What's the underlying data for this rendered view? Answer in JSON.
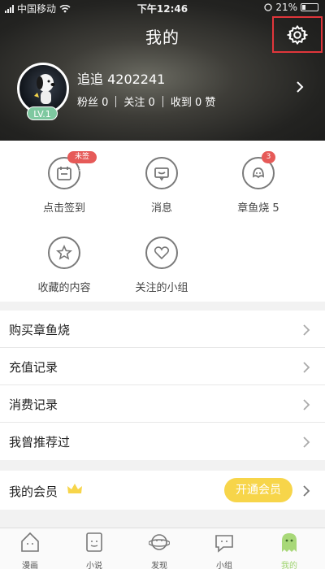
{
  "status_bar": {
    "carrier": "中国移动",
    "time": "下午12:46",
    "battery": "21%"
  },
  "header": {
    "title": "我的",
    "username": "追追 4202241",
    "level": "LV.1",
    "stats": {
      "fans": "粉丝 0",
      "follow": "关注 0",
      "likes": "收到 0 赞"
    }
  },
  "grid": {
    "items": [
      {
        "label": "点击签到",
        "icon": "checkin-icon",
        "tag": "未签到"
      },
      {
        "label": "消息",
        "icon": "message-icon"
      },
      {
        "label": "章鱼烧 5",
        "icon": "octopus-icon",
        "tag": "3"
      },
      {
        "label": "收藏的内容",
        "icon": "star-icon"
      },
      {
        "label": "关注的小组",
        "icon": "heart-icon"
      }
    ]
  },
  "list": {
    "items": [
      {
        "label": "购买章鱼烧"
      },
      {
        "label": "充值记录"
      },
      {
        "label": "消费记录"
      },
      {
        "label": "我曾推荐过"
      }
    ]
  },
  "member": {
    "label": "我的会员",
    "button": "开通会员"
  },
  "tabs": [
    {
      "label": "漫画",
      "active": false
    },
    {
      "label": "小说",
      "active": false
    },
    {
      "label": "发现",
      "active": false
    },
    {
      "label": "小组",
      "active": false
    },
    {
      "label": "我的",
      "active": true
    }
  ],
  "colors": {
    "accent": "#f7d54a",
    "badge": "#e65a58",
    "active_tab": "#9fd46f",
    "highlight": "#e0363b"
  }
}
